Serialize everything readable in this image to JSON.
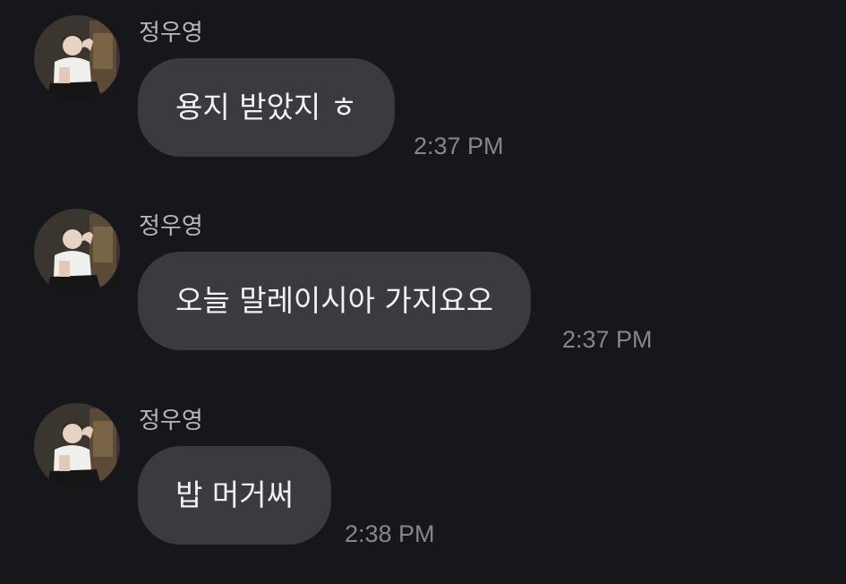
{
  "chat": {
    "messages": [
      {
        "sender": "정우영",
        "text": "용지 받았지 ㅎ",
        "time": "2:37 PM",
        "avatar_icon": "profile-photo"
      },
      {
        "sender": "정우영",
        "text": "오늘 말레이시아 가지요오",
        "time": "2:37 PM",
        "avatar_icon": "profile-photo"
      },
      {
        "sender": "정우영",
        "text": "밥 머거써",
        "time": "2:38 PM",
        "avatar_icon": "profile-photo"
      }
    ]
  },
  "colors": {
    "background": "#16171b",
    "bubble": "#393b41",
    "message_text": "#f2f2f4",
    "sender_text": "#b7b8bd",
    "timestamp_text": "#84868c"
  }
}
